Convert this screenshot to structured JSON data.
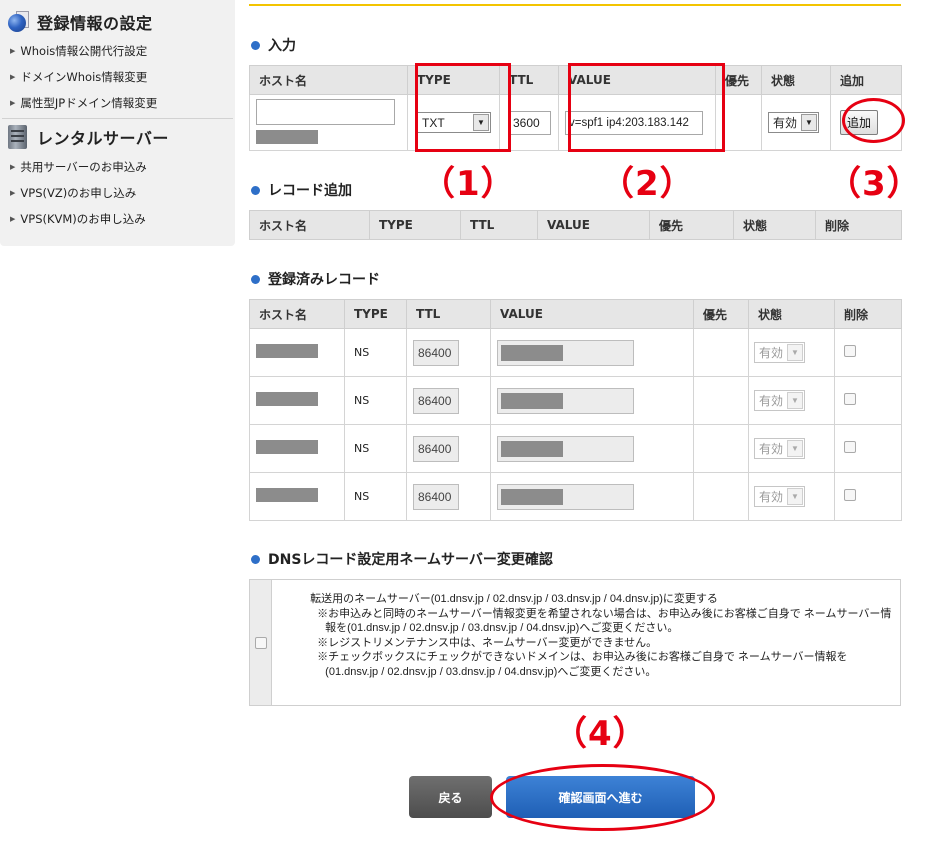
{
  "sidebar": {
    "registration": {
      "title": "登録情報の設定",
      "icon": "globe-book-icon",
      "items": [
        "Whois情報公開代行設定",
        "ドメインWhois情報変更",
        "属性型JPドメイン情報変更"
      ]
    },
    "rental": {
      "title": "レンタルサーバー",
      "icon": "server-icon",
      "items": [
        "共用サーバーのお申込み",
        "VPS(VZ)のお申し込み",
        "VPS(KVM)のお申し込み"
      ]
    }
  },
  "input_section": {
    "title": "入力",
    "headers": [
      "ホスト名",
      "TYPE",
      "TTL",
      "VALUE",
      "優先",
      "状態",
      "追加"
    ],
    "row": {
      "host": "",
      "type": "TXT",
      "ttl": "3600",
      "value": "v=spf1 ip4:203.183.142",
      "priority": "",
      "status": "有効",
      "add_label": "追加"
    }
  },
  "record_add_section": {
    "title": "レコード追加",
    "headers": [
      "ホスト名",
      "TYPE",
      "TTL",
      "VALUE",
      "優先",
      "状態",
      "削除"
    ]
  },
  "registered_section": {
    "title": "登録済みレコード",
    "headers": [
      "ホスト名",
      "TYPE",
      "TTL",
      "VALUE",
      "優先",
      "状態",
      "削除"
    ],
    "rows": [
      {
        "type": "NS",
        "ttl": "86400",
        "status": "有効"
      },
      {
        "type": "NS",
        "ttl": "86400",
        "status": "有効"
      },
      {
        "type": "NS",
        "ttl": "86400",
        "status": "有効"
      },
      {
        "type": "NS",
        "ttl": "86400",
        "status": "有効"
      }
    ]
  },
  "dns_confirm": {
    "title": "DNSレコード設定用ネームサーバー変更確認",
    "lines": [
      "転送用のネームサーバー(01.dnsv.jp / 02.dnsv.jp / 03.dnsv.jp / 04.dnsv.jp)に変更する",
      "※お申込みと同時のネームサーバー情報変更を希望されない場合は、お申込み後にお客様ご自身で ネームサーバー情報を(01.dnsv.jp / 02.dnsv.jp / 03.dnsv.jp / 04.dnsv.jp)へご変更ください。",
      "※レジストリメンテナンス中は、ネームサーバー変更ができません。",
      "※チェックボックスにチェックができないドメインは、お申込み後にお客様ご自身で ネームサーバー情報を(01.dnsv.jp / 02.dnsv.jp / 03.dnsv.jp / 04.dnsv.jp)へご変更ください。"
    ]
  },
  "buttons": {
    "back": "戻る",
    "next": "確認画面へ進む"
  },
  "annotations": [
    "（1）",
    "（2）",
    "（3）",
    "（4）"
  ],
  "colors": {
    "accent_bar": "#f3c400",
    "highlight": "#e60012",
    "primary_button": "#2a6fc4",
    "section_dot": "#2e6fc8"
  }
}
